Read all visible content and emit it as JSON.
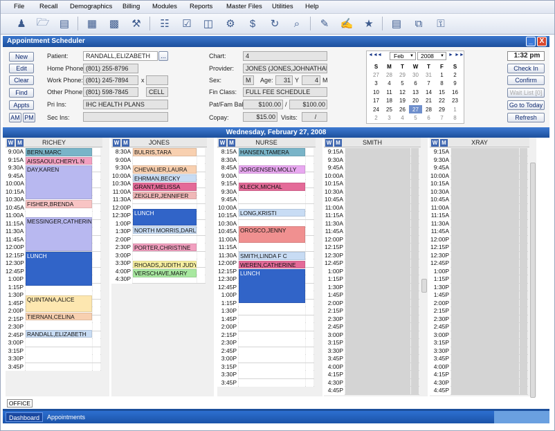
{
  "menu": [
    "File",
    "Recall",
    "Demographics",
    "Billing",
    "Modules",
    "Reports",
    "Master Files",
    "Utilities",
    "Help"
  ],
  "toolbar_icons": [
    "person-icon",
    "folder-icon",
    "document-icon",
    "calendar-icon",
    "chart-icon",
    "tools-icon",
    "calculator-icon",
    "checklist-icon",
    "cash-register-icon",
    "car-icon",
    "dollar-icon",
    "refresh-clock-icon",
    "search-page-icon",
    "edit-note-icon",
    "write-icon",
    "pen-icon",
    "money-icon",
    "window-icon",
    "key-icon"
  ],
  "window": {
    "title": "Appointment Scheduler",
    "min": "_",
    "close": "X"
  },
  "buttons": {
    "new": "New",
    "edit": "Edit",
    "clear": "Clear",
    "find": "Find",
    "appts": "Appts",
    "am": "AM",
    "pm": "PM",
    "lookup": "...",
    "check_in": "Check In",
    "confirm": "Confirm",
    "wait_list": "Wait List [0]",
    "go_today": "Go to Today",
    "refresh": "Refresh"
  },
  "patient": {
    "label_patient": "Patient:",
    "name": "RANDALL,ELIZABETH",
    "label_home": "Home Phone:",
    "home": "(801) 255-8796",
    "label_work": "Work Phone:",
    "work": "(801) 245-7894",
    "x": "x",
    "label_other": "Other Phone:",
    "other": "(801) 598-7845",
    "other_type": "CELL",
    "label_pri": "Pri Ins:",
    "pri": "IHC HEALTH PLANS",
    "label_sec": "Sec Ins:",
    "sec": ""
  },
  "account": {
    "label_chart": "Chart:",
    "chart": "4",
    "label_provider": "Provider:",
    "provider": "JONES (JONES,JOHNATHAN)",
    "label_sex": "Sex:",
    "sex": "M",
    "label_age": "Age:",
    "age": "31",
    "age_y": "Y",
    "age_m_val": "4",
    "age_m": "M",
    "label_fin": "Fin Class:",
    "fin": "FULL FEE SCHEDULE",
    "label_bal": "Pat/Fam Bal:",
    "pat_bal": "$100.00",
    "slash": "/",
    "fam_bal": "$100.00",
    "label_copay": "Copay:",
    "copay": "$15.00",
    "label_visits": "Visits:",
    "visits": "/"
  },
  "calendar": {
    "month": "Feb",
    "year": "2008",
    "nav_first": "◄◄",
    "nav_prev": "◄",
    "nav_next": "►",
    "nav_last": "►►",
    "days": [
      "S",
      "M",
      "T",
      "W",
      "T",
      "F",
      "S"
    ],
    "weeks": [
      [
        "27",
        "28",
        "29",
        "30",
        "31",
        "1",
        "2"
      ],
      [
        "3",
        "4",
        "5",
        "6",
        "7",
        "8",
        "9"
      ],
      [
        "10",
        "11",
        "12",
        "13",
        "14",
        "15",
        "16"
      ],
      [
        "17",
        "18",
        "19",
        "20",
        "21",
        "22",
        "23"
      ],
      [
        "24",
        "25",
        "26",
        "27",
        "28",
        "29",
        "1"
      ],
      [
        "2",
        "3",
        "4",
        "5",
        "6",
        "7",
        "8"
      ]
    ],
    "selected": "27"
  },
  "clock": "1:32 pm",
  "date_header": "Wednesday, February 27, 2008",
  "wm": [
    "W",
    "M"
  ],
  "columns": [
    {
      "name": "RICHEY",
      "times": [
        "9:00A",
        "9:15A",
        "9:30A",
        "9:45A",
        "10:00A",
        "10:15A",
        "10:30A",
        "10:45A",
        "11:00A",
        "11:15A",
        "11:30A",
        "11:45A",
        "12:00P",
        "12:15P",
        "12:30P",
        "12:45P",
        "1:00P",
        "1:15P",
        "1:30P",
        "1:45P",
        "2:00P",
        "2:15P",
        "2:30P",
        "2:45P",
        "3:00P",
        "3:15P",
        "3:30P",
        "3:45P"
      ],
      "appts": [
        {
          "row": 0,
          "span": 1,
          "text": "BERN,MARC",
          "color": "#79b4c8"
        },
        {
          "row": 1,
          "span": 1,
          "text": "AISSAOUI,CHERYL N",
          "color": "#f2a0c0"
        },
        {
          "row": 2,
          "span": 4,
          "text": "DAY,KAREN",
          "color": "#b8b8f0"
        },
        {
          "row": 6,
          "span": 1,
          "text": "FISHER,BRENDA",
          "color": "#f8c4c4"
        },
        {
          "row": 8,
          "span": 4,
          "text": "MESSINGER,CATHERINE",
          "color": "#b8b8f0"
        },
        {
          "row": 12,
          "span": 4,
          "text": "LUNCH",
          "color": "#3164c8",
          "fg": "#fff"
        },
        {
          "row": 17,
          "span": 2,
          "text": "QUINTANA,ALICE",
          "color": "#fde7b0"
        },
        {
          "row": 19,
          "span": 1,
          "text": "TIERNAN,CELINA",
          "color": "#f8d0b0"
        },
        {
          "row": 21,
          "span": 1,
          "text": "RANDALL,ELIZABETH",
          "color": "#c8dcf4"
        }
      ]
    },
    {
      "name": "JONES",
      "times": [
        "8:30A",
        "9:00A",
        "9:30A",
        "10:00A",
        "10:30A",
        "11:00A",
        "11:30A",
        "12:00P",
        "12:30P",
        "1:00P",
        "1:30P",
        "2:00P",
        "2:30P",
        "3:00P",
        "3:30P",
        "4:00P",
        "4:30P"
      ],
      "appts": [
        {
          "row": 0,
          "span": 1,
          "text": "BULRIS,TARA",
          "color": "#f8d0b0"
        },
        {
          "row": 2,
          "span": 1,
          "text": "CHEVALIER,LAURA",
          "color": "#f8d0b0"
        },
        {
          "row": 3,
          "span": 1,
          "text": "EHRMAN,BECKY",
          "color": "#c8dcf4"
        },
        {
          "row": 4,
          "span": 1,
          "text": "GRANT,MELISSA",
          "color": "#e46a98"
        },
        {
          "row": 5,
          "span": 1,
          "text": "ZEIGLER,JENNIFER",
          "color": "#f0b8b8"
        },
        {
          "row": 7,
          "span": 2,
          "text": "LUNCH",
          "color": "#3164c8",
          "fg": "#fff"
        },
        {
          "row": 9,
          "span": 1,
          "text": "NORTH MORRIS,DARLINE",
          "color": "#c8dcf4"
        },
        {
          "row": 11,
          "span": 1,
          "text": "PORTER,CHRISTINE",
          "color": "#f2a0c0"
        },
        {
          "row": 13,
          "span": 1,
          "text": "RHOADS,JUDITH JUDY",
          "color": "#f8f0a0"
        },
        {
          "row": 14,
          "span": 1,
          "text": "VERSCHAVE,MARY",
          "color": "#a8e8a0"
        }
      ]
    },
    {
      "name": "NURSE",
      "times": [
        "8:15A",
        "8:30A",
        "8:45A",
        "9:00A",
        "9:15A",
        "9:30A",
        "9:45A",
        "10:00A",
        "10:15A",
        "10:30A",
        "10:45A",
        "11:00A",
        "11:15A",
        "11:30A",
        "12:00P",
        "12:15P",
        "12:30P",
        "12:45P",
        "1:00P",
        "1:15P",
        "1:30P",
        "1:45P",
        "2:00P",
        "2:15P",
        "2:30P",
        "2:45P",
        "3:00P",
        "3:15P",
        "3:30P",
        "3:45P"
      ],
      "appts": [
        {
          "row": 0,
          "span": 1,
          "text": "HANSEN,TAMERA",
          "color": "#79b4c8"
        },
        {
          "row": 2,
          "span": 1,
          "text": "JORGENSEN,MOLLY",
          "color": "#e8a8f0"
        },
        {
          "row": 4,
          "span": 1,
          "text": "KLECK,MICHAL",
          "color": "#e46a98"
        },
        {
          "row": 7,
          "span": 1,
          "text": "LONG,KRISTI",
          "color": "#c8dcf4"
        },
        {
          "row": 9,
          "span": 2,
          "text": "OROSCO,JENNY",
          "color": "#f09090"
        },
        {
          "row": 12,
          "span": 1,
          "text": "SMITH,LINDA F C",
          "color": "#c8dcf4"
        },
        {
          "row": 13,
          "span": 1,
          "text": "WEREN,CATHERINE",
          "color": "#e46a98"
        },
        {
          "row": 14,
          "span": 4,
          "text": "LUNCH",
          "color": "#3164c8",
          "fg": "#fff"
        }
      ]
    },
    {
      "name": "SMITH",
      "times": [
        "9:15A",
        "9:30A",
        "9:45A",
        "10:00A",
        "10:15A",
        "10:30A",
        "10:45A",
        "11:00A",
        "11:15A",
        "11:30A",
        "11:45A",
        "12:00P",
        "12:15P",
        "12:30P",
        "12:45P",
        "1:00P",
        "1:15P",
        "1:30P",
        "1:45P",
        "2:00P",
        "2:15P",
        "2:30P",
        "2:45P",
        "3:00P",
        "3:15P",
        "3:30P",
        "3:45P",
        "4:00P",
        "4:15P",
        "4:30P",
        "4:45P"
      ],
      "appts": []
    },
    {
      "name": "XRAY",
      "times": [
        "9:15A",
        "9:30A",
        "9:45A",
        "10:00A",
        "10:15A",
        "10:30A",
        "10:45A",
        "11:00A",
        "11:15A",
        "11:30A",
        "11:45A",
        "12:00P",
        "12:15P",
        "12:30P",
        "12:45P",
        "1:00P",
        "1:15P",
        "1:30P",
        "1:45P",
        "2:00P",
        "2:15P",
        "2:30P",
        "2:45P",
        "3:00P",
        "3:15P",
        "3:30P",
        "3:45P",
        "4:00P",
        "4:15P",
        "4:30P",
        "4:45P"
      ],
      "appts": []
    }
  ],
  "office_tab": "OFFICE",
  "taskbar": [
    "Dashboard",
    "Appointments"
  ]
}
